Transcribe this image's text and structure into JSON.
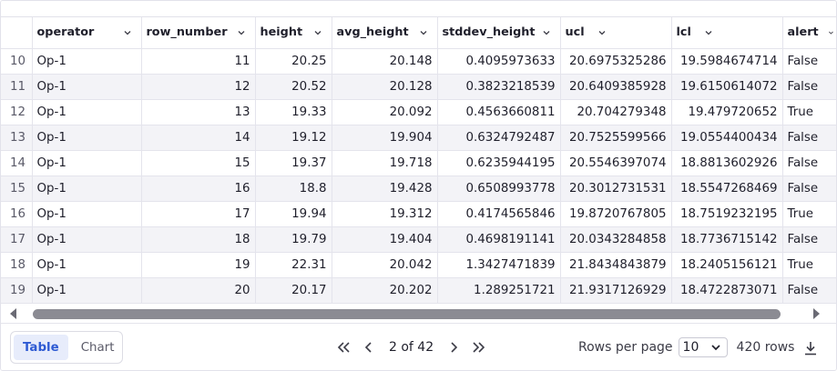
{
  "columns": [
    {
      "key": "index",
      "label": ""
    },
    {
      "key": "operator",
      "label": "operator"
    },
    {
      "key": "row_number",
      "label": "row_number"
    },
    {
      "key": "height",
      "label": "height"
    },
    {
      "key": "avg_height",
      "label": "avg_height"
    },
    {
      "key": "stddev_height",
      "label": "stddev_height"
    },
    {
      "key": "ucl",
      "label": "ucl"
    },
    {
      "key": "lcl",
      "label": "lcl"
    },
    {
      "key": "alert",
      "label": "alert"
    }
  ],
  "rows": [
    [
      "10",
      "Op-1",
      "11",
      "20.25",
      "20.148",
      "0.4095973633",
      "20.6975325286",
      "19.5984674714",
      "False"
    ],
    [
      "11",
      "Op-1",
      "12",
      "20.52",
      "20.128",
      "0.3823218539",
      "20.6409385928",
      "19.6150614072",
      "False"
    ],
    [
      "12",
      "Op-1",
      "13",
      "19.33",
      "20.092",
      "0.4563660811",
      "20.704279348",
      "19.479720652",
      "True"
    ],
    [
      "13",
      "Op-1",
      "14",
      "19.12",
      "19.904",
      "0.6324792487",
      "20.7525599566",
      "19.0554400434",
      "False"
    ],
    [
      "14",
      "Op-1",
      "15",
      "19.37",
      "19.718",
      "0.6235944195",
      "20.5546397074",
      "18.8813602926",
      "False"
    ],
    [
      "15",
      "Op-1",
      "16",
      "18.8",
      "19.428",
      "0.6508993778",
      "20.3012731531",
      "18.5547268469",
      "False"
    ],
    [
      "16",
      "Op-1",
      "17",
      "19.94",
      "19.312",
      "0.4174565846",
      "19.8720767805",
      "18.7519232195",
      "True"
    ],
    [
      "17",
      "Op-1",
      "18",
      "19.79",
      "19.404",
      "0.4698191141",
      "20.0343284858",
      "18.7736715142",
      "False"
    ],
    [
      "18",
      "Op-1",
      "19",
      "22.31",
      "20.042",
      "1.3427471839",
      "21.8434843879",
      "18.2405156121",
      "True"
    ],
    [
      "19",
      "Op-1",
      "20",
      "20.17",
      "20.202",
      "1.289251721",
      "21.9317126929",
      "18.4722873071",
      "False"
    ]
  ],
  "view_toggle": {
    "table_label": "Table",
    "chart_label": "Chart",
    "active": "Table"
  },
  "pagination": {
    "page_text": "2 of 42"
  },
  "rows_per_page": {
    "label": "Rows per page",
    "value": "10",
    "total_text": "420 rows"
  },
  "colors": {
    "accent": "#2f5bd3",
    "active_bg": "#e7ecfb",
    "scroll_thumb": "#8b8b93"
  },
  "icons": {
    "first_page": "double-chevron-left-icon",
    "prev_page": "chevron-left-icon",
    "next_page": "chevron-right-icon",
    "last_page": "double-chevron-right-icon",
    "download": "download-icon"
  }
}
